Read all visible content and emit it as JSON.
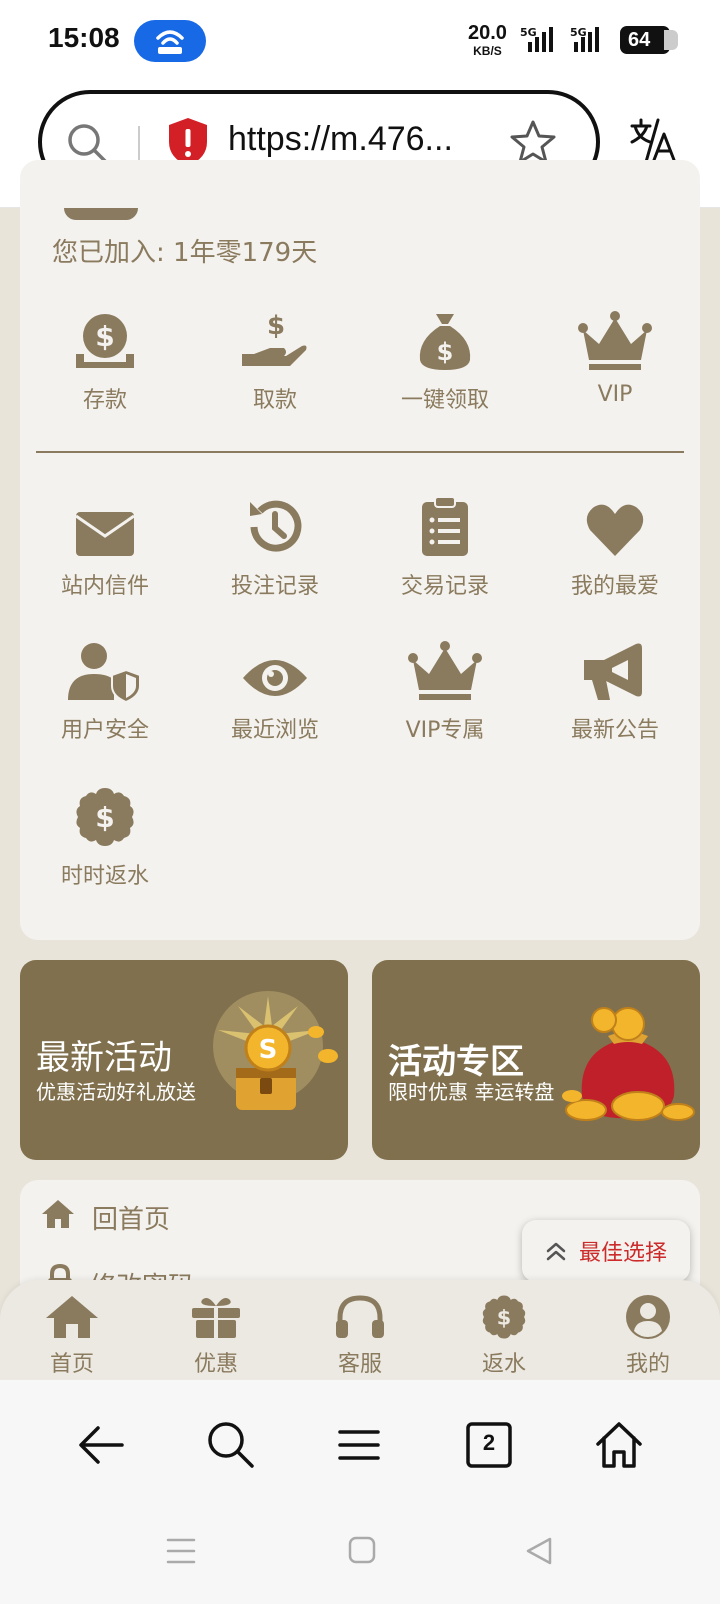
{
  "status_bar": {
    "time": "15:08",
    "net_speed": "20.0",
    "net_unit": "KB/S",
    "signal1_label": "5G",
    "signal2_label": "5G",
    "battery": "64"
  },
  "browser": {
    "url": "https://m.476...",
    "tab_count": "2"
  },
  "account": {
    "joined_text": "您已加入: 1年零179天"
  },
  "quick_actions": [
    {
      "label": "存款",
      "icon": "deposit-icon"
    },
    {
      "label": "取款",
      "icon": "withdraw-icon"
    },
    {
      "label": "一键领取",
      "icon": "money-bag-icon"
    },
    {
      "label": "VIP",
      "icon": "crown-icon"
    }
  ],
  "menu_grid": [
    {
      "label": "站内信件",
      "icon": "envelope-icon"
    },
    {
      "label": "投注记录",
      "icon": "history-icon"
    },
    {
      "label": "交易记录",
      "icon": "clipboard-icon"
    },
    {
      "label": "我的最爱",
      "icon": "heart-icon"
    },
    {
      "label": "用户安全",
      "icon": "user-shield-icon"
    },
    {
      "label": "最近浏览",
      "icon": "eye-icon"
    },
    {
      "label": "VIP专属",
      "icon": "crown-icon"
    },
    {
      "label": "最新公告",
      "icon": "megaphone-icon"
    },
    {
      "label": "时时返水",
      "icon": "dollar-badge-icon"
    }
  ],
  "promos": [
    {
      "title": "最新活动",
      "subtitle": "优惠活动好礼放送"
    },
    {
      "title": "活动专区",
      "subtitle": "限时优惠 幸运转盘"
    }
  ],
  "list_menu": {
    "home_label": "回首页",
    "password_label": "修改密码"
  },
  "best_choice": "最佳选择",
  "tabbar": [
    {
      "label": "首页",
      "icon": "home-icon"
    },
    {
      "label": "优惠",
      "icon": "gift-icon"
    },
    {
      "label": "客服",
      "icon": "headset-icon"
    },
    {
      "label": "返水",
      "icon": "dollar-badge-icon"
    },
    {
      "label": "我的",
      "icon": "user-circle-icon"
    }
  ],
  "colors": {
    "accent": "#8a7a5e",
    "promo_bg": "#80704d",
    "panel_bg": "#f4f2ee",
    "page_bg": "#e8e4da",
    "highlight_red": "#cc2b2b"
  }
}
